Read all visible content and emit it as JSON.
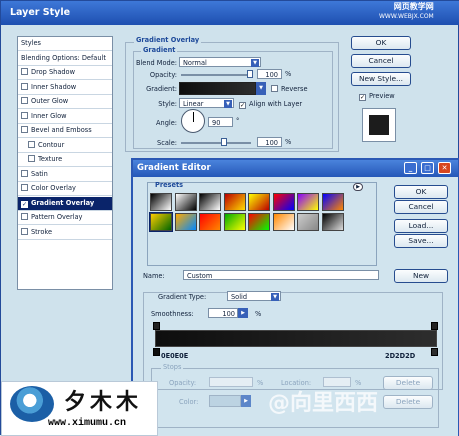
{
  "layer_style": {
    "title": "Layer Style",
    "styles": [
      {
        "label": "Styles",
        "cb": false,
        "indent": false,
        "selected": false
      },
      {
        "label": "Blending Options: Default",
        "cb": false,
        "indent": false,
        "selected": false
      },
      {
        "label": "Drop Shadow",
        "cb": true,
        "checked": false,
        "indent": false,
        "selected": false
      },
      {
        "label": "Inner Shadow",
        "cb": true,
        "checked": false,
        "indent": false,
        "selected": false
      },
      {
        "label": "Outer Glow",
        "cb": true,
        "checked": false,
        "indent": false,
        "selected": false
      },
      {
        "label": "Inner Glow",
        "cb": true,
        "checked": false,
        "indent": false,
        "selected": false
      },
      {
        "label": "Bevel and Emboss",
        "cb": true,
        "checked": false,
        "indent": false,
        "selected": false
      },
      {
        "label": "Contour",
        "cb": true,
        "checked": false,
        "indent": true,
        "selected": false
      },
      {
        "label": "Texture",
        "cb": true,
        "checked": false,
        "indent": true,
        "selected": false
      },
      {
        "label": "Satin",
        "cb": true,
        "checked": false,
        "indent": false,
        "selected": false
      },
      {
        "label": "Color Overlay",
        "cb": true,
        "checked": false,
        "indent": false,
        "selected": false
      },
      {
        "label": "Gradient Overlay",
        "cb": true,
        "checked": true,
        "indent": false,
        "selected": true
      },
      {
        "label": "Pattern Overlay",
        "cb": true,
        "checked": false,
        "indent": false,
        "selected": false
      },
      {
        "label": "Stroke",
        "cb": true,
        "checked": false,
        "indent": false,
        "selected": false
      }
    ],
    "group_title": "Gradient Overlay",
    "sub_title": "Gradient",
    "blend_mode_label": "Blend Mode:",
    "blend_mode_value": "Normal",
    "opacity_label": "Opacity:",
    "opacity_value": "100",
    "opacity_unit": "%",
    "gradient_label": "Gradient:",
    "reverse_label": "Reverse",
    "style_label": "Style:",
    "style_value": "Linear",
    "align_label": "Align with Layer",
    "angle_label": "Angle:",
    "angle_value": "90",
    "angle_unit": "°",
    "scale_label": "Scale:",
    "scale_value": "100",
    "scale_unit": "%",
    "buttons": {
      "ok": "OK",
      "cancel": "Cancel",
      "new_style": "New Style...",
      "preview": "Preview"
    }
  },
  "gradient_editor": {
    "title": "Gradient Editor",
    "presets_label": "Presets",
    "buttons": {
      "ok": "OK",
      "reset": "Cancel",
      "load": "Load...",
      "save": "Save...",
      "new": "New"
    },
    "name_label": "Name:",
    "name_value": "Custom",
    "type_label": "Gradient Type:",
    "type_value": "Solid",
    "smoothness_label": "Smoothness:",
    "smoothness_value": "100",
    "smoothness_unit": "%",
    "stop_left": "0E0E0E",
    "stop_right": "2D2D2D",
    "stops_label": "Stops",
    "stop_opacity_label": "Opacity:",
    "stop_opacity_unit": "%",
    "location_label": "Location:",
    "location_unit": "%",
    "color_label": "Color:",
    "delete_label": "Delete",
    "preset_colors": [
      [
        "#000",
        "#fff"
      ],
      [
        "#fff",
        "#000"
      ],
      [
        "#000",
        "#fff"
      ],
      [
        "#b00",
        "#fd0"
      ],
      [
        "#ff0",
        "#b00"
      ],
      [
        "#f00",
        "#00f"
      ],
      [
        "#80f",
        "#ff0"
      ],
      [
        "#00f",
        "#f80"
      ],
      [
        "#fc0",
        "#060"
      ],
      [
        "#fa0",
        "#08f"
      ],
      [
        "#f00",
        "#f80"
      ],
      [
        "#0a0",
        "#ff0"
      ],
      [
        "#f00",
        "#0f0"
      ],
      [
        "#f80",
        "#fff"
      ],
      [
        "#ccc",
        "#888"
      ],
      [
        "#000",
        "#ddd"
      ]
    ]
  },
  "watermark_top": {
    "line1": "网页教学网",
    "line2": "WWW.WEBJX.COM"
  },
  "logo": {
    "chars": "夕木木",
    "url": "www.ximumu.cn"
  },
  "watermark_bottom": "@向里西西"
}
